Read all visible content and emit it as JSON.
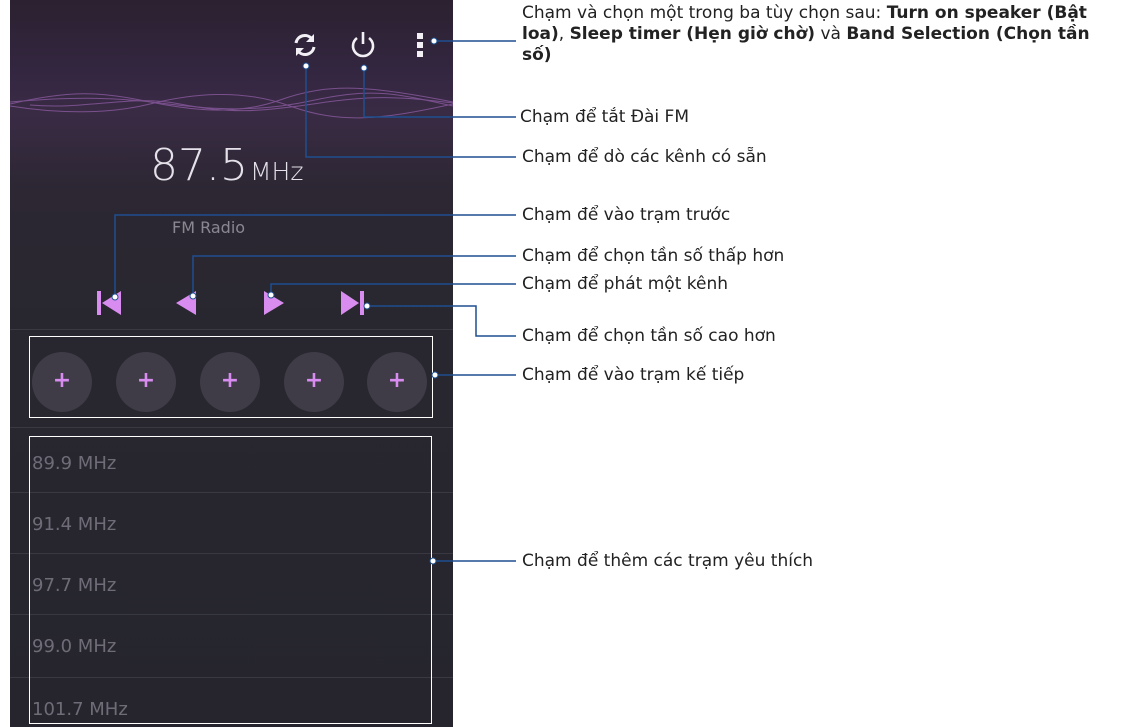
{
  "radio": {
    "frequency": "87.5",
    "unit": "MHz",
    "label": "FM Radio",
    "preset_symbol": "+",
    "stations": [
      "89.9 MHz",
      "91.4 MHz",
      "97.7 MHz",
      "99.0 MHz",
      "101.7 MHz"
    ]
  },
  "icons": [
    "refresh-icon",
    "power-icon",
    "more-menu-icon",
    "skip-previous-icon",
    "step-down-icon",
    "step-up-icon",
    "skip-next-icon"
  ],
  "colors": {
    "accent": "#d98cf0",
    "background": "#26252d",
    "callout_line": "#1f4f8f"
  },
  "callouts": {
    "menu": {
      "prefix": "Chạm và chọn một trong ba tùy chọn sau: ",
      "opt1": "Turn on speaker (Bật loa)",
      "sep1": ", ",
      "opt2": "Sleep timer (Hẹn giờ chờ)",
      "sep2": " và ",
      "opt3": "Band Selection (Chọn tần số)"
    },
    "power": "Chạm để tắt Đài FM",
    "scan": "Chạm để dò các kênh có sẵn",
    "prev_station": "Chạm để vào trạm trước",
    "lower_freq": "Chạm để chọn tần số thấp hơn",
    "play": "Chạm để phát một kênh",
    "higher_freq": "Chạm để chọn tần số cao hơn",
    "next_station": "Chạm để vào trạm kế tiếp",
    "favorites": "Chạm để thêm các trạm yêu thích"
  }
}
